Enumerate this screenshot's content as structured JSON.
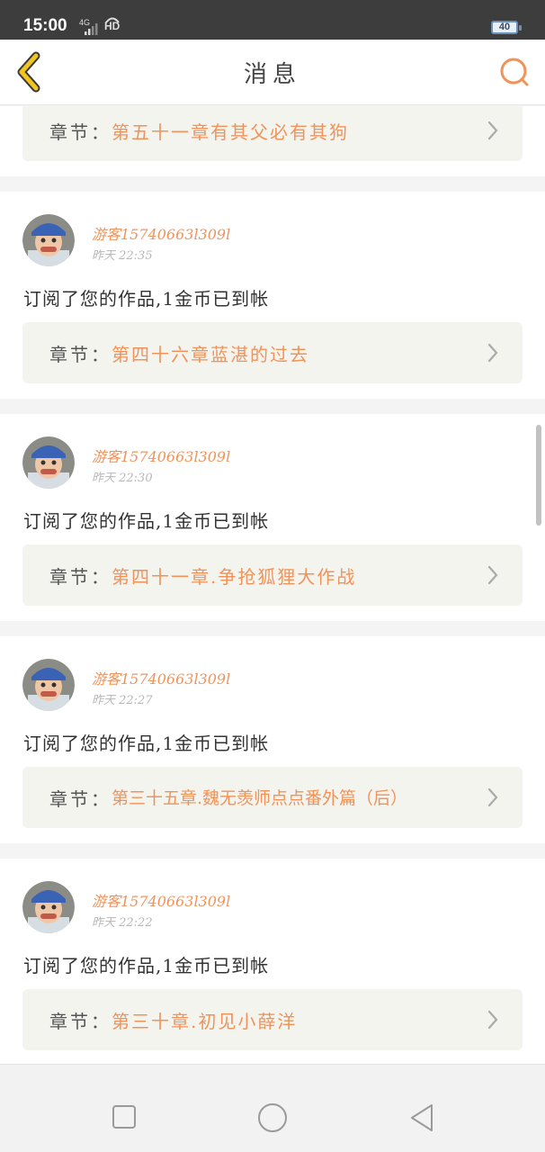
{
  "status_bar": {
    "time": "15:00",
    "network": "4G",
    "hd": "HD",
    "battery": "40"
  },
  "header": {
    "title": "消息",
    "back_icon": "chevron-left-icon",
    "search_icon": "search-icon"
  },
  "colors": {
    "accent": "#f0935a",
    "back_icon": "#f3c51f",
    "chapter_bg": "#f4f4ef"
  },
  "partial_top": {
    "chapter_label": "章节：",
    "chapter_title": "第五十一章有其父必有其狗"
  },
  "messages": [
    {
      "username": "游客15740663l309l",
      "time": "昨天 22:35",
      "text": "订阅了您的作品,1金币已到帐",
      "chapter_label": "章节：",
      "chapter_title": "第四十六章蓝湛的过去"
    },
    {
      "username": "游客15740663l309l",
      "time": "昨天 22:30",
      "text": "订阅了您的作品,1金币已到帐",
      "chapter_label": "章节：",
      "chapter_title": "第四十一章.争抢狐狸大作战"
    },
    {
      "username": "游客15740663l309l",
      "time": "昨天 22:27",
      "text": "订阅了您的作品,1金币已到帐",
      "chapter_label": "章节：",
      "chapter_title": "第三十五章.魏无羡师点点番外篇（后）"
    },
    {
      "username": "游客15740663l309l",
      "time": "昨天 22:22",
      "text": "订阅了您的作品,1金币已到帐",
      "chapter_label": "章节：",
      "chapter_title": "第三十章.初见小薛洋"
    }
  ],
  "system_nav": {
    "recent": "square-icon",
    "home": "circle-icon",
    "back": "triangle-back-icon"
  }
}
